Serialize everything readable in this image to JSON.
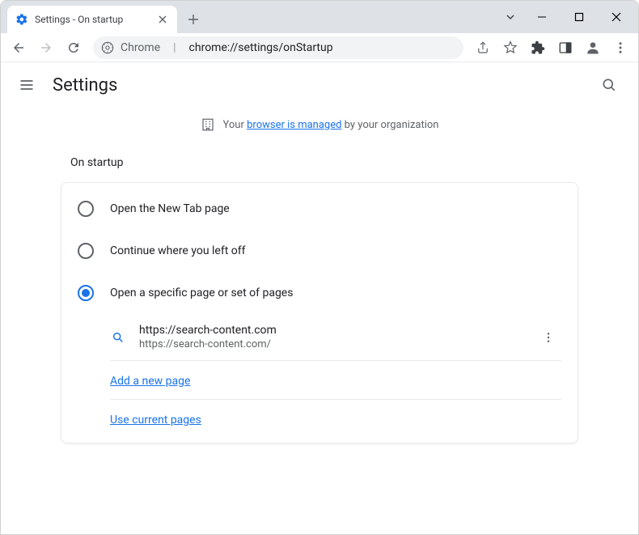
{
  "window": {
    "tab_title": "Settings - On startup"
  },
  "toolbar": {
    "chrome_label": "Chrome",
    "url_path": "chrome://settings/onStartup"
  },
  "settings": {
    "title": "Settings",
    "managed_prefix": "Your ",
    "managed_link": "browser is managed",
    "managed_suffix": " by your organization",
    "section_title": "On startup",
    "options": [
      {
        "label": "Open the New Tab page"
      },
      {
        "label": "Continue where you left off"
      },
      {
        "label": "Open a specific page or set of pages"
      }
    ],
    "pages": [
      {
        "title": "https://search-content.com",
        "url": "https://search-content.com/"
      }
    ],
    "add_page_label": "Add a new page",
    "use_current_label": "Use current pages"
  }
}
